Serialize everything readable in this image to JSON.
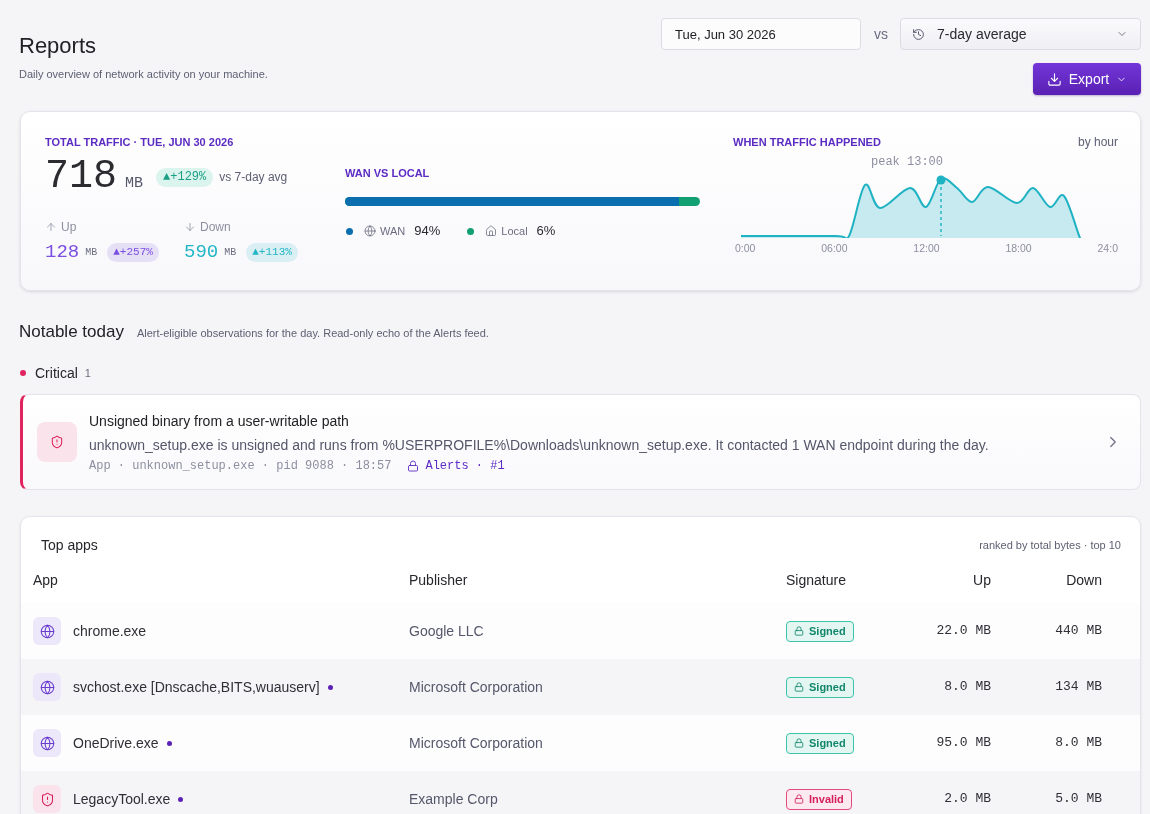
{
  "header": {
    "title": "Reports",
    "subtitle": "Daily overview of network activity on your machine.",
    "date": {
      "value": "Tue, Jun 30 2026"
    },
    "vs_label": "vs",
    "comparison": {
      "label": "7-day average"
    },
    "export_button": "Export"
  },
  "traffic_card": {
    "total": {
      "title": "TOTAL TRAFFIC · TUE, JUN 30 2026",
      "value": "718",
      "unit": "MB",
      "change": "▲+129%",
      "comparison": "vs 7-day avg"
    },
    "split": [
      {
        "kind": "up",
        "label": "Up",
        "value": "128",
        "unit": "MB",
        "change": "▲+257%",
        "color": "#7b4fdf"
      },
      {
        "kind": "down",
        "label": "Down",
        "value": "590",
        "unit": "MB",
        "change": "▲+113%",
        "color": "#22b6c6"
      }
    ],
    "wan_vs_local": {
      "title": "WAN VS LOCAL",
      "level": 0.94,
      "legend": [
        {
          "kind": "wan",
          "label": "WAN",
          "value": "94%",
          "color": "#0b6eae"
        },
        {
          "kind": "local",
          "label": "Local",
          "value": "6%",
          "color": "#12a072"
        }
      ]
    },
    "hourly": {
      "title": "WHEN TRAFFIC HAPPENED",
      "unit_label": "by hour",
      "peak_label": "peak 13:00",
      "x_labels": [
        "0:00",
        "06:00",
        "12:00",
        "18:00",
        "24:0"
      ]
    }
  },
  "notable": {
    "title": "Notable today",
    "subtitle": "Alert-eligible observations for the day. Read-only echo of the Alerts feed.",
    "groups": [
      {
        "label": "Critical",
        "count": "1",
        "color": "#e0245e",
        "alerts": [
          {
            "title": "Unsigned binary from a user-writable path",
            "description": "unknown_setup.exe is unsigned and runs from %USERPROFILE%\\Downloads\\unknown_setup.exe. It contacted 1 WAN endpoint during the day.",
            "meta": "App · unknown_setup.exe · pid 9088 · 18:57",
            "link": "Alerts · #1"
          }
        ]
      }
    ]
  },
  "top_apps": {
    "title": "Top apps",
    "note": "ranked by total bytes · top 10",
    "columns": [
      "App",
      "Publisher",
      "Signature",
      "Up",
      "Down"
    ],
    "rows": [
      {
        "name": "chrome.exe",
        "marked": false,
        "publisher": "Google LLC",
        "signature": {
          "kind": "signed",
          "label": "Signed"
        },
        "up": "22.0 MB",
        "down": "440 MB"
      },
      {
        "name": "svchost.exe [Dnscache,BITS,wuauserv]",
        "marked": true,
        "publisher": "Microsoft Corporation",
        "signature": {
          "kind": "signed",
          "label": "Signed"
        },
        "up": "8.0 MB",
        "down": "134 MB"
      },
      {
        "name": "OneDrive.exe",
        "marked": true,
        "publisher": "Microsoft Corporation",
        "signature": {
          "kind": "signed",
          "label": "Signed"
        },
        "up": "95.0 MB",
        "down": "8.0 MB"
      },
      {
        "name": "LegacyTool.exe",
        "marked": true,
        "publisher": "Example Corp",
        "signature": {
          "kind": "invalid",
          "label": "Invalid"
        },
        "up": "2.0 MB",
        "down": "5.0 MB"
      }
    ]
  }
}
